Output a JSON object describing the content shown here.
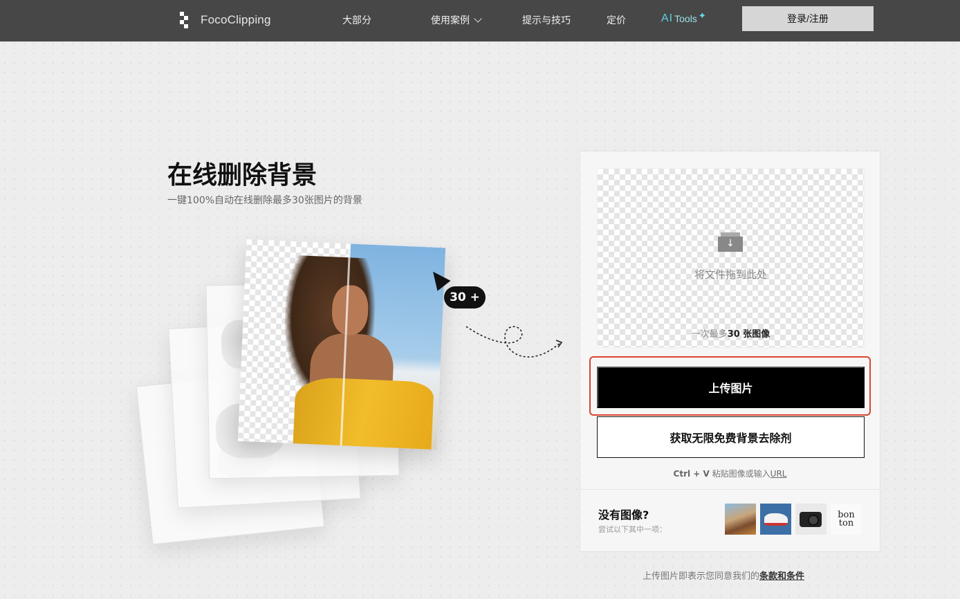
{
  "nav": {
    "brand": "FocoClipping",
    "items": [
      "大部分",
      "使用案例",
      "提示与技巧",
      "定价"
    ],
    "ai_tools": {
      "ai": "AI",
      "tools": "Tools"
    },
    "login_label": "登录/注册",
    "bg_color": "#474747"
  },
  "hero": {
    "title": "在线删除背景",
    "subtitle": "一键100%自动在线删除最多30张图片的背景",
    "badge": "30 +"
  },
  "upload": {
    "drop_text": "将文件拖到此处",
    "limit_prefix": "一次最多",
    "limit_bold": "30 张图像",
    "upload_label": "上传图片",
    "free_label": "获取无限免费背景去除剂",
    "paste_keys": "Ctrl + V",
    "paste_text": "粘贴图像或输入",
    "paste_url": "URL",
    "no_image_title": "没有图像?",
    "no_image_sub": "尝试以下其中一项：",
    "samples": [
      "woman",
      "sneaker",
      "camera",
      "bonton"
    ],
    "sample4_l1": "bon",
    "sample4_l2": "ton",
    "highlight_color": "#d9452f"
  },
  "footer": {
    "terms_prefix": "上传图片即表示您同意我们的",
    "terms_link": "条款和条件"
  },
  "icons": {
    "drop_arrow": "↓",
    "sparkle": "✦"
  }
}
